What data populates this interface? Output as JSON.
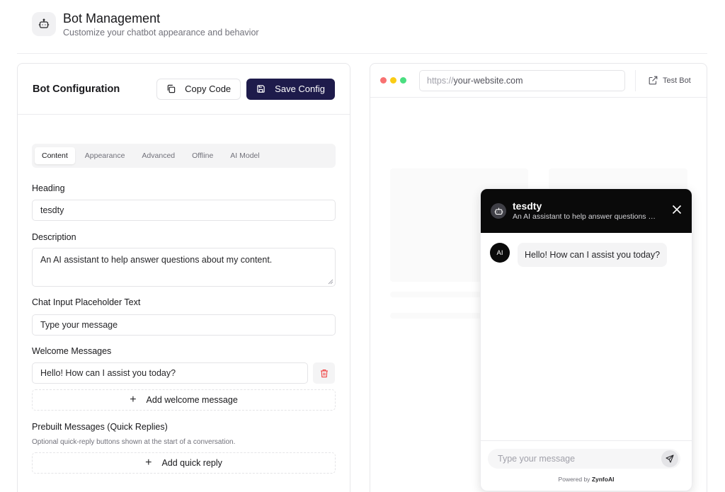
{
  "header": {
    "title": "Bot Management",
    "subtitle": "Customize your chatbot appearance and behavior"
  },
  "config": {
    "title": "Bot Configuration",
    "copy_label": "Copy Code",
    "save_label": "Save Config",
    "tabs": [
      {
        "label": "Content",
        "active": true
      },
      {
        "label": "Appearance",
        "active": false
      },
      {
        "label": "Advanced",
        "active": false
      },
      {
        "label": "Offline",
        "active": false
      },
      {
        "label": "AI Model",
        "active": false
      }
    ],
    "heading_label": "Heading",
    "heading_value": "tesdty",
    "description_label": "Description",
    "description_value": "An AI assistant to help answer questions about my content.",
    "placeholder_label": "Chat Input Placeholder Text",
    "placeholder_value": "Type your message",
    "welcome_label": "Welcome Messages",
    "welcome_value": "Hello! How can I assist you today?",
    "add_welcome_label": "Add welcome message",
    "prebuilt_label": "Prebuilt Messages (Quick Replies)",
    "prebuilt_help": "Optional quick-reply buttons shown at the start of a conversation.",
    "add_quick_label": "Add quick reply"
  },
  "preview": {
    "url_proto": "https://",
    "url_host": "your-website.com",
    "test_label": "Test Bot",
    "dot_colors": [
      "#f87171",
      "#facc15",
      "#4ade80"
    ]
  },
  "chat": {
    "name": "tesdty",
    "description": "An AI assistant to help answer questions about my content.",
    "ai_badge": "AI",
    "welcome": "Hello! How can I assist you today?",
    "input_placeholder": "Type your message",
    "powered_prefix": "Powered by",
    "powered_brand": "ZynfoAI"
  },
  "icons": [
    "bot-icon",
    "copy-icon",
    "save-icon",
    "trash-icon",
    "external-link-icon",
    "close-icon",
    "send-icon",
    "plus-icon"
  ],
  "colors": {
    "primary": "#1e1b4b",
    "chat_header": "#0a0a0a",
    "danger": "#ef4444"
  }
}
